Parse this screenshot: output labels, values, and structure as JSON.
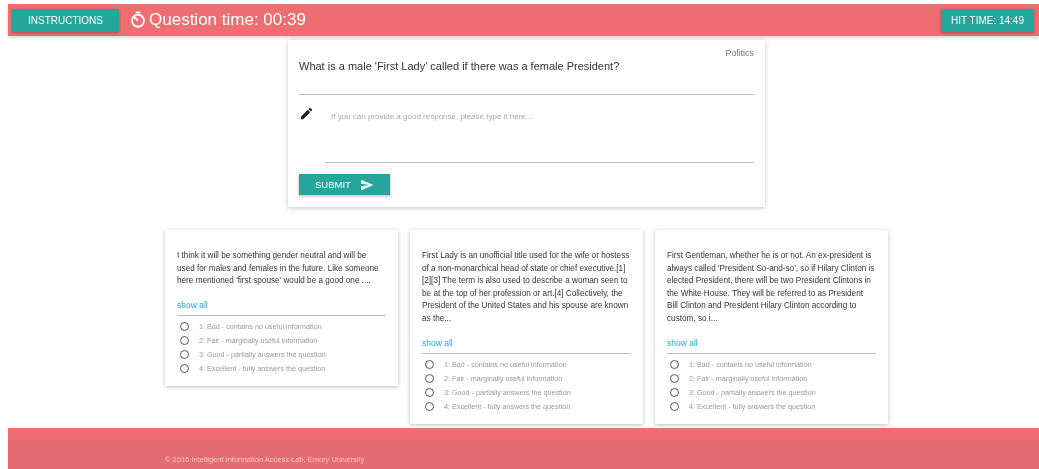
{
  "header": {
    "instructions_button": "INSTRUCTIONS",
    "question_timer": "Question time: 00:39",
    "hit_time": "HIT TIME: 14:49"
  },
  "question": {
    "category": "Politics",
    "text": "What is a male 'First Lady' called if there was a female President?",
    "answer_placeholder": "If you can provide a good response, please type it here...",
    "submit_button": "SUBMIT"
  },
  "answers": [
    {
      "text": "I think it will be something gender neutral and will be used for males and females in the future. Like someone here mentioned 'first spouse' would be a good one ....",
      "show_all": "show all",
      "ratings": [
        {
          "label": "1: Bad - contains no useful information",
          "selected": false
        },
        {
          "label": "2: Fair - marginally useful information",
          "selected": false
        },
        {
          "label": "3: Good - partially answers the question",
          "selected": false
        },
        {
          "label": "4: Excellent - fully answers the question",
          "selected": false
        }
      ]
    },
    {
      "text": "First Lady is an unofficial title used for the wife or hostess of a non-monarchical head of state or chief executive.[1][2][3] The term is also used to describe a woman seen to be at the top of her profession or art.[4] Collectively, the President of the United States and his spouse are known as the...",
      "show_all": "show all",
      "ratings": [
        {
          "label": "1: Bad - contains no useful information",
          "selected": false
        },
        {
          "label": "2: Fair - marginally useful information",
          "selected": false
        },
        {
          "label": "3: Good - partially answers the question",
          "selected": false
        },
        {
          "label": "4: Excellent - fully answers the question",
          "selected": false
        }
      ]
    },
    {
      "text": "First Gentleman, whether he is or not. An ex-president is always called 'President So-and-so', so if Hilary Clinton is elected President, there will be two President Clintons in the White House. They will be referred to as President Bill Clinton and President Hilary Clinton according to custom, so i...",
      "show_all": "show all",
      "ratings": [
        {
          "label": "1: Bad - contains no useful information",
          "selected": false
        },
        {
          "label": "2: Fair - marginally useful information",
          "selected": false
        },
        {
          "label": "3: Good - partially answers the question",
          "selected": false
        },
        {
          "label": "4: Excellent - fully answers the question",
          "selected": false
        }
      ]
    }
  ],
  "footer": {
    "copyright": "© 2016 Intelligent Information Access Lab, Emory University"
  }
}
